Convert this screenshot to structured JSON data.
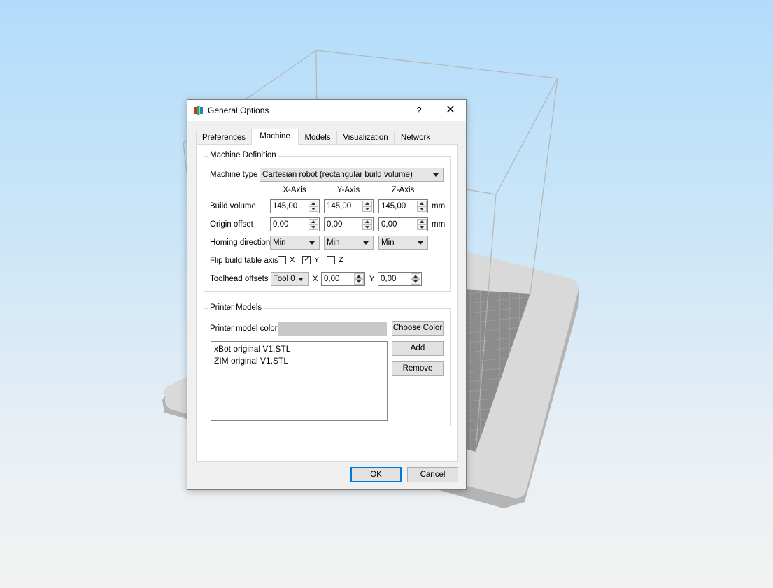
{
  "dialog": {
    "title": "General Options",
    "help_label": "?",
    "close_label": "✕"
  },
  "tabs": [
    {
      "label": "Preferences"
    },
    {
      "label": "Machine"
    },
    {
      "label": "Models"
    },
    {
      "label": "Visualization"
    },
    {
      "label": "Network"
    }
  ],
  "active_tab": "Machine",
  "machine_definition": {
    "group_title": "Machine Definition",
    "machine_type_label": "Machine type",
    "machine_type_value": "Cartesian robot (rectangular build volume)",
    "axis_headers": [
      "X-Axis",
      "Y-Axis",
      "Z-Axis"
    ],
    "build_volume": {
      "label": "Build volume",
      "values": [
        "145,00",
        "145,00",
        "145,00"
      ],
      "unit": "mm"
    },
    "origin_offset": {
      "label": "Origin offset",
      "values": [
        "0,00",
        "0,00",
        "0,00"
      ],
      "unit": "mm"
    },
    "homing_direction": {
      "label": "Homing direction",
      "values": [
        "Min",
        "Min",
        "Min"
      ]
    },
    "flip_axis": {
      "label": "Flip build table axis",
      "options": [
        {
          "label": "X",
          "checked": false
        },
        {
          "label": "Y",
          "checked": true
        },
        {
          "label": "Z",
          "checked": false
        }
      ]
    },
    "toolhead_offsets": {
      "label": "Toolhead offsets",
      "tool_value": "Tool 0",
      "x_label": "X",
      "x_value": "0,00",
      "y_label": "Y",
      "y_value": "0,00"
    }
  },
  "printer_models": {
    "group_title": "Printer Models",
    "color_label": "Printer model color",
    "color_value": "#c8c8c8",
    "choose_color_label": "Choose Color",
    "add_label": "Add",
    "remove_label": "Remove",
    "items": [
      "xBot original V1.STL",
      "ZIM original V1.STL"
    ]
  },
  "footer": {
    "ok_label": "OK",
    "cancel_label": "Cancel"
  }
}
